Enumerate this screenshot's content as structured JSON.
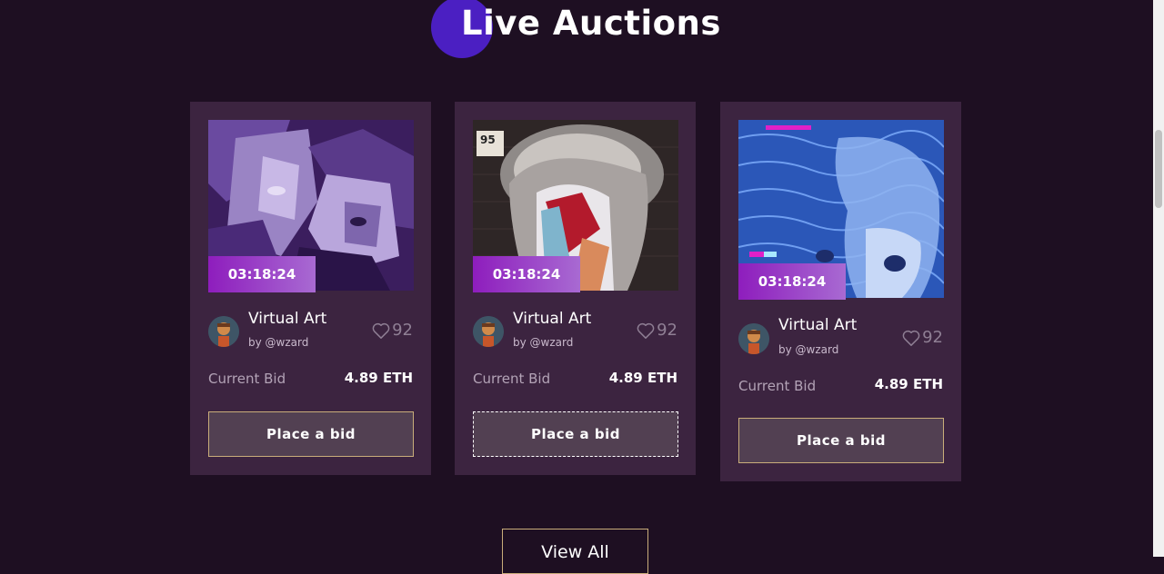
{
  "section": {
    "title": "Live Auctions",
    "view_all_label": "View All"
  },
  "cards": [
    {
      "timer": "03:18:24",
      "title": "Virtual Art",
      "author": "by @wzard",
      "likes": "92",
      "bid_label": "Current Bid",
      "bid_value": "4.89 ETH",
      "button_label": "Place a bid",
      "image": "purple-cubist-faces-artwork"
    },
    {
      "timer": "03:18:24",
      "title": "Virtual Art",
      "author": "by @wzard",
      "likes": "92",
      "bid_label": "Current Bid",
      "bid_value": "4.89 ETH",
      "button_label": "Place a bid",
      "image": "street-art-portrait-artwork",
      "image_sign": "95"
    },
    {
      "timer": "03:18:24",
      "title": "Virtual Art",
      "author": "by @wzard",
      "likes": "92",
      "bid_label": "Current Bid",
      "bid_value": "4.89 ETH",
      "button_label": "Place a bid",
      "image": "blue-glitch-statue-artwork"
    }
  ],
  "colors": {
    "background": "#1e0f22",
    "card": "#3c2440",
    "accent_circle": "#4b1fc2",
    "timer_start": "#8e1dbd",
    "timer_end": "#a86ad2",
    "button_border": "#c9ad7a"
  }
}
